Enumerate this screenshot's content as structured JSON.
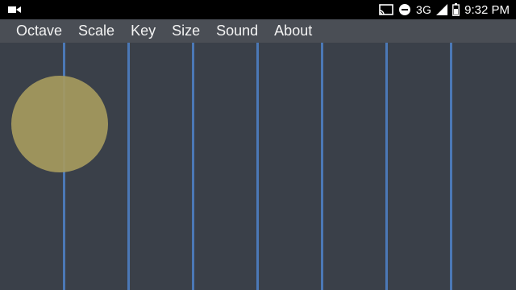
{
  "statusbar": {
    "left_icon": "video-camera-icon",
    "icons": [
      "cast-icon",
      "do-not-disturb-icon"
    ],
    "network": "3G",
    "signal_icon": "cell-signal-icon",
    "battery_icon": "battery-icon",
    "time": "9:32 PM"
  },
  "menu": {
    "items": [
      {
        "label": "Octave"
      },
      {
        "label": "Scale"
      },
      {
        "label": "Key"
      },
      {
        "label": "Size"
      },
      {
        "label": "Sound"
      },
      {
        "label": "About"
      }
    ]
  },
  "board": {
    "line_color": "#4b78b6",
    "background": "#3a4049",
    "touch_color": "#a69a5e"
  }
}
